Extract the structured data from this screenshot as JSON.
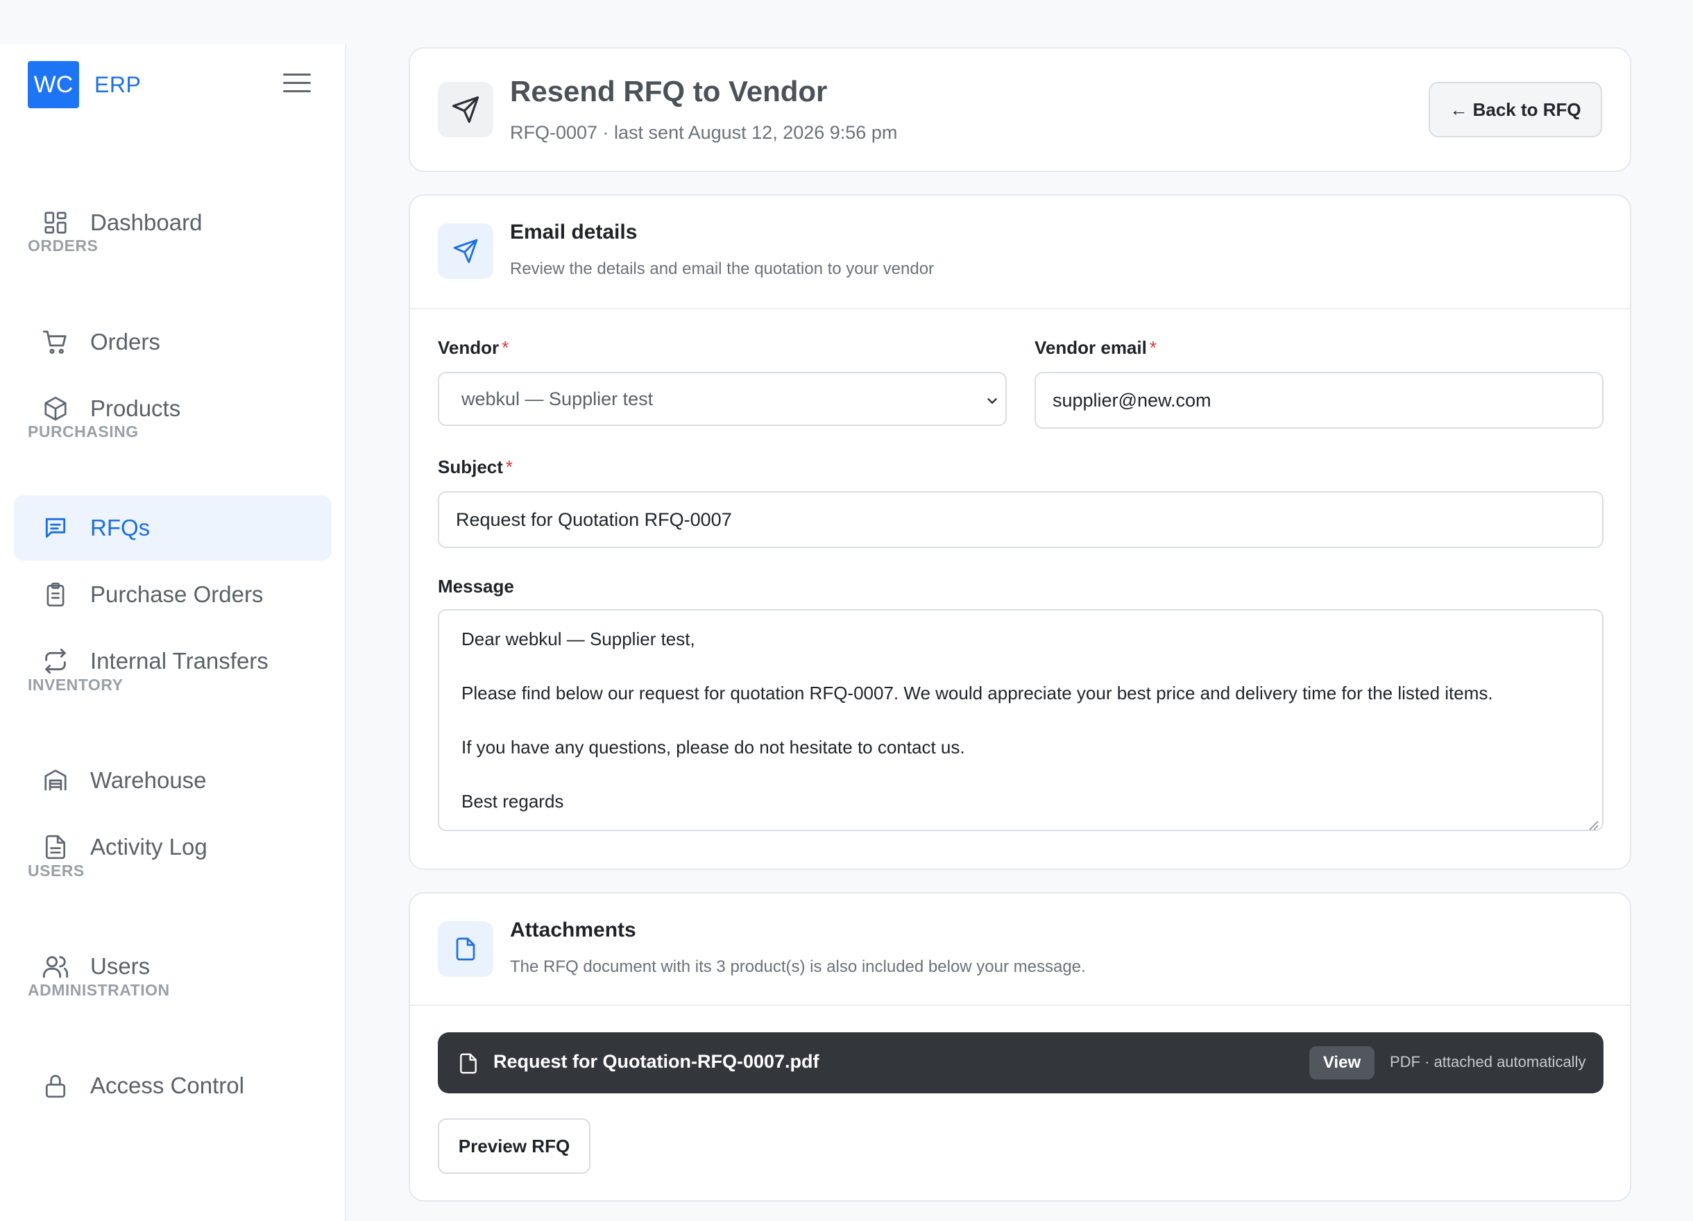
{
  "brand": {
    "logo": "WC",
    "name": "ERP"
  },
  "sidebar": {
    "dashboard": "Dashboard",
    "sections": {
      "orders": "ORDERS",
      "purchasing": "PURCHASING",
      "inventory": "INVENTORY",
      "users": "USERS",
      "administration": "ADMINISTRATION"
    },
    "items": {
      "orders": "Orders",
      "products": "Products",
      "rfqs": "RFQs",
      "purchase_orders": "Purchase Orders",
      "internal_transfers": "Internal Transfers",
      "warehouse": "Warehouse",
      "activity_log": "Activity Log",
      "users": "Users",
      "access_control": "Access Control"
    },
    "active_item": "rfqs"
  },
  "header": {
    "title": "Resend RFQ to Vendor",
    "subtitle": "RFQ-0007 · last sent August 12, 2026 9:56 pm",
    "back_button": "← Back to RFQ"
  },
  "email_details": {
    "title": "Email details",
    "description": "Review the details and email the quotation to your vendor",
    "vendor_label": "Vendor",
    "vendor_value": "webkul — Supplier test",
    "vendor_email_label": "Vendor email",
    "vendor_email_value": "supplier@new.com",
    "subject_label": "Subject",
    "subject_value": "Request for Quotation RFQ-0007",
    "message_label": "Message",
    "required_mark": "*",
    "message_lines": [
      "Dear webkul — Supplier test,",
      "Please find below our request for quotation RFQ-0007. We would appreciate your best price and delivery time for the listed items.",
      "If you have any questions, please do not hesitate to contact us.",
      "Best regards"
    ]
  },
  "attachments": {
    "title": "Attachments",
    "description": "The RFQ document with its 3 product(s) is also included below your message.",
    "file_name": "Request for Quotation-RFQ-0007.pdf",
    "view_button": "View",
    "file_meta": "PDF · attached automatically",
    "preview_button": "Preview RFQ"
  },
  "colors": {
    "accent": "#1d74f5",
    "active_bg": "#edf4fe",
    "required": "#d93636",
    "file_bar": "#33373c"
  }
}
